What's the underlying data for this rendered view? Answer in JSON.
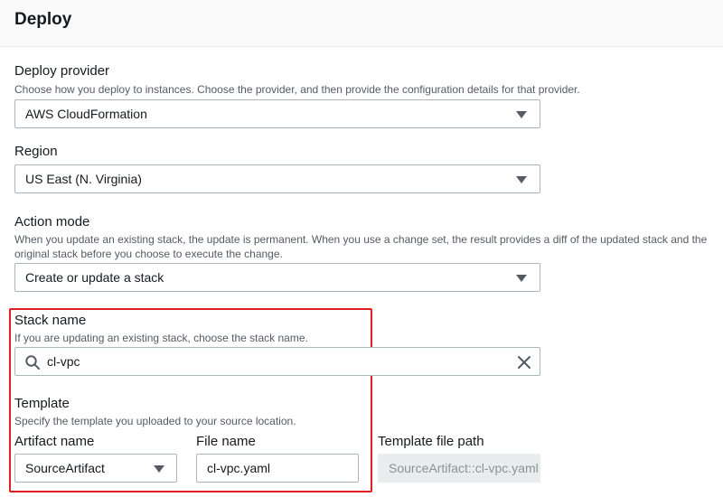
{
  "section": {
    "title": "Deploy"
  },
  "deploy_provider": {
    "label": "Deploy provider",
    "description": "Choose how you deploy to instances. Choose the provider, and then provide the configuration details for that provider.",
    "value": "AWS CloudFormation"
  },
  "region": {
    "label": "Region",
    "value": "US East (N. Virginia)"
  },
  "action_mode": {
    "label": "Action mode",
    "description": "When you update an existing stack, the update is permanent. When you use a change set, the result provides a diff of the updated stack and the original stack before you choose to execute the change.",
    "value": "Create or update a stack"
  },
  "stack_name": {
    "label": "Stack name",
    "description": "If you are updating an existing stack, choose the stack name.",
    "value": "cl-vpc"
  },
  "template": {
    "label": "Template",
    "description": "Specify the template you uploaded to your source location.",
    "artifact_label": "Artifact name",
    "artifact_value": "SourceArtifact",
    "file_label": "File name",
    "file_value": "cl-vpc.yaml",
    "path_label": "Template file path",
    "path_value": "SourceArtifact::cl-vpc.yaml"
  },
  "icons": {
    "search": "search-icon",
    "clear": "close-icon",
    "dropdown": "caret-down-icon"
  },
  "colors": {
    "highlight": "#e02020",
    "border": "#aab7b8",
    "secondary_text": "#545b64"
  }
}
